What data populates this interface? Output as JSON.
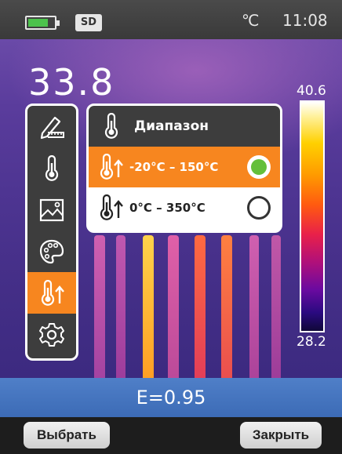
{
  "status": {
    "sd_label": "SD",
    "unit": "℃",
    "time": "11:08",
    "battery_level": 0.7
  },
  "measurement": {
    "value": "33.8"
  },
  "scale": {
    "max": "40.6",
    "min": "28.2"
  },
  "tools": [
    {
      "name": "measure-tool",
      "icon": "pencil-ruler-icon"
    },
    {
      "name": "thermometer-tool",
      "icon": "thermometer-icon"
    },
    {
      "name": "image-tool",
      "icon": "image-icon"
    },
    {
      "name": "palette-tool",
      "icon": "palette-icon"
    },
    {
      "name": "range-tool",
      "icon": "thermometer-up-icon",
      "active": true
    },
    {
      "name": "settings-tool",
      "icon": "gear-icon"
    }
  ],
  "range_dialog": {
    "title": "Диапазон",
    "options": [
      {
        "label": "-20°C – 150°C",
        "selected": true
      },
      {
        "label": "0°C – 350°C",
        "selected": false
      }
    ]
  },
  "emissivity": "E=0.95",
  "softkeys": {
    "left": "Выбрать",
    "right": "Закрыть"
  },
  "colors": {
    "accent": "#f7861f",
    "radio_on": "#64bf3a",
    "emissivity_bar": "#4574be"
  }
}
